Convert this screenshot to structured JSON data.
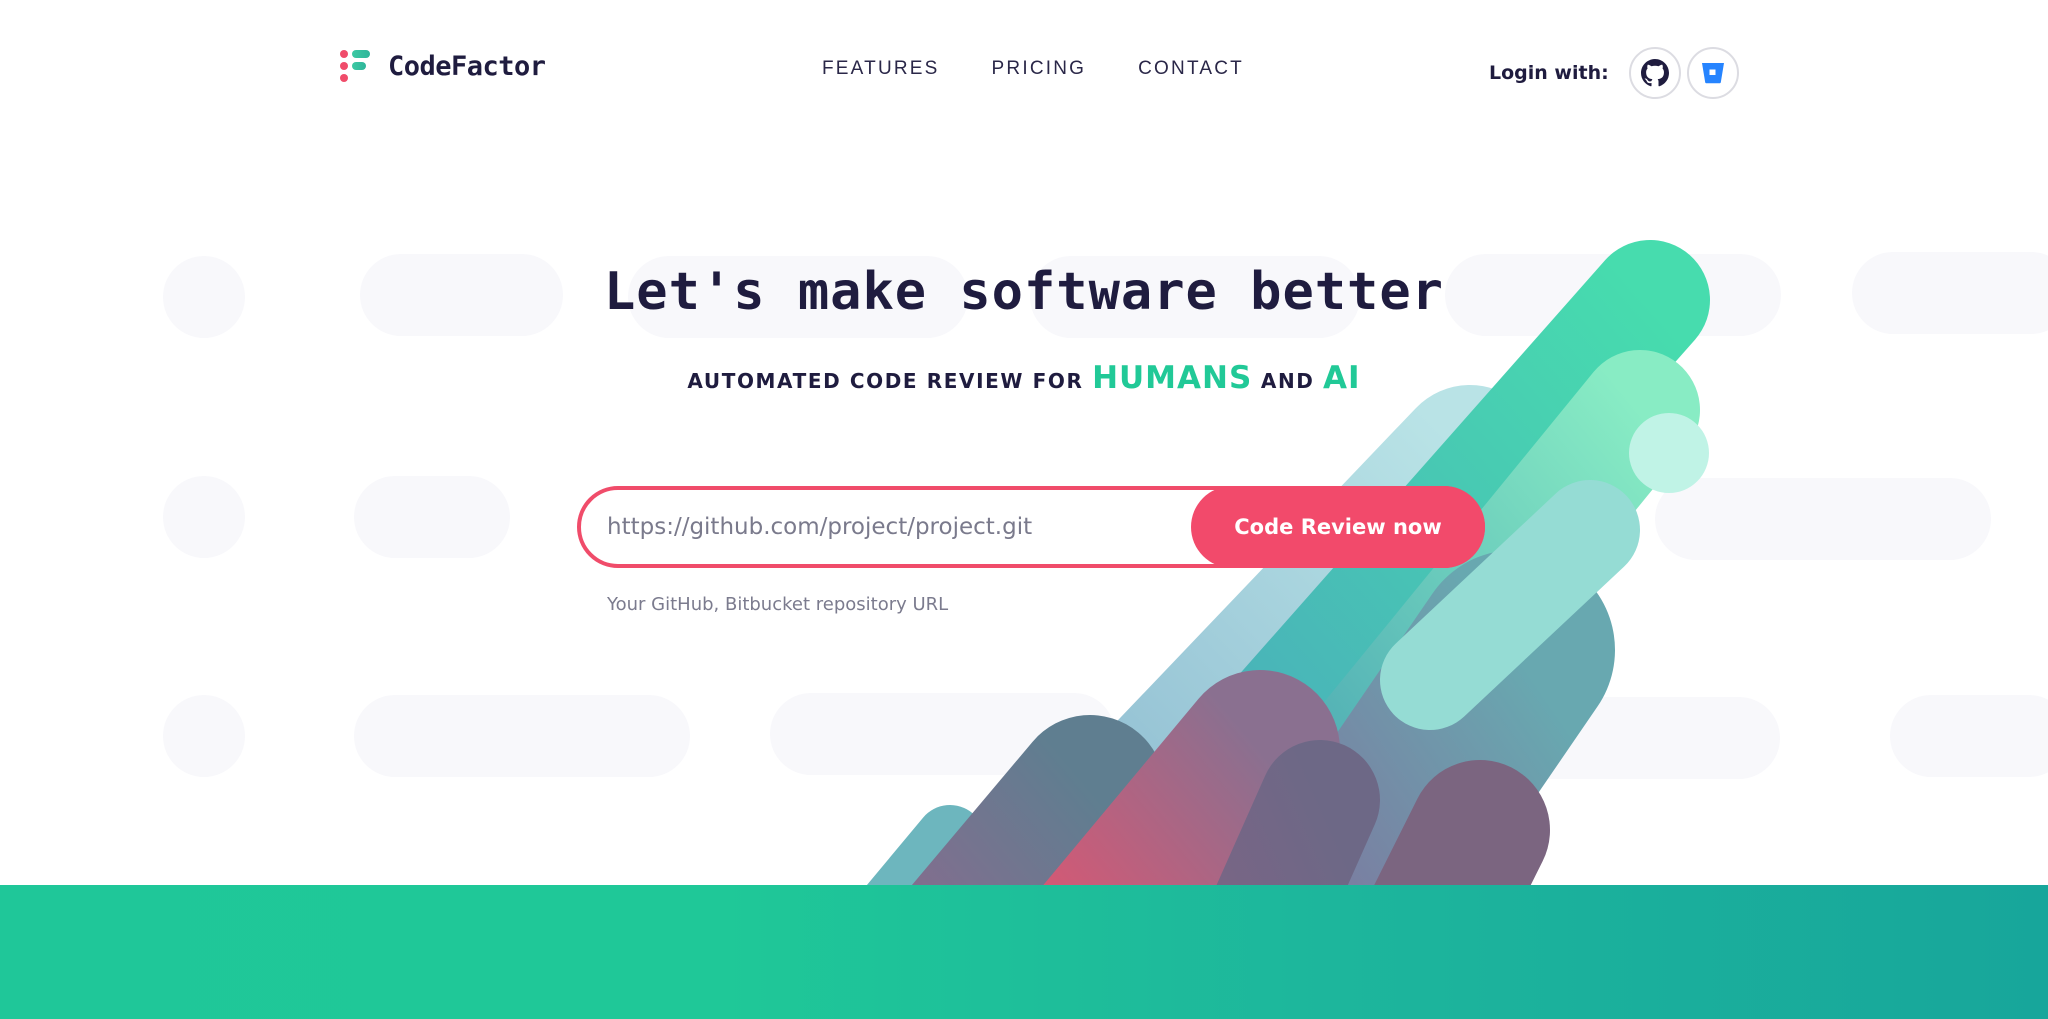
{
  "brand": {
    "name": "CodeFactor",
    "colors": {
      "primary_dark": "#1f1c3f",
      "accent_pink": "#f24a6b",
      "accent_green": "#21c997",
      "footer_teal": "#1db69c",
      "bitbucket_blue": "#2684ff"
    }
  },
  "nav": {
    "items": [
      {
        "label": "FEATURES"
      },
      {
        "label": "PRICING"
      },
      {
        "label": "CONTACT"
      }
    ]
  },
  "login": {
    "label": "Login with:",
    "providers": [
      {
        "name": "GitHub",
        "icon": "github-icon"
      },
      {
        "name": "Bitbucket",
        "icon": "bitbucket-icon"
      }
    ]
  },
  "hero": {
    "title": "Let's make software better",
    "subtitle_prefix": "AUTOMATED CODE REVIEW FOR ",
    "subtitle_humans": "HUMANS",
    "subtitle_and": " AND ",
    "subtitle_ai": "AI"
  },
  "review_form": {
    "input_value": "",
    "input_placeholder": "https://github.com/project/project.git",
    "button_label": "Code Review now",
    "hint": "Your GitHub, Bitbucket repository URL"
  }
}
